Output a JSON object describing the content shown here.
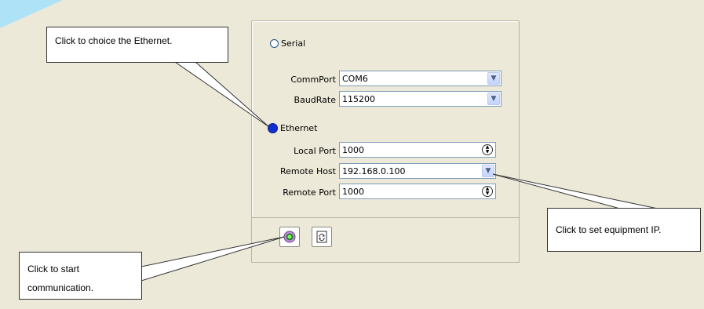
{
  "connection": {
    "serial_label": "Serial",
    "ethernet_label": "Ethernet",
    "selected": "Ethernet"
  },
  "serial": {
    "commport_label": "CommPort",
    "commport_value": "COM6",
    "baudrate_label": "BaudRate",
    "baudrate_value": "115200"
  },
  "ethernet": {
    "local_port_label": "Local Port",
    "local_port_value": "1000",
    "remote_host_label": "Remote Host",
    "remote_host_value": "192.168.0.100",
    "remote_port_label": "Remote Port",
    "remote_port_value": "1000"
  },
  "callouts": {
    "ethernet": "Click to choice the Ethernet.",
    "equipment_ip": "Click to set equipment IP.",
    "start_line1": "Click to start",
    "start_line2": "communication."
  },
  "icons": {
    "start": "start-communication-icon",
    "refresh": "refresh-icon",
    "dropdown": "chevron-down-icon",
    "spin": "spin-updown-icon"
  },
  "colors": {
    "background": "#ece9d8",
    "radio_selected": "#0f2fd0",
    "corner_accent": "#aee3f7"
  }
}
